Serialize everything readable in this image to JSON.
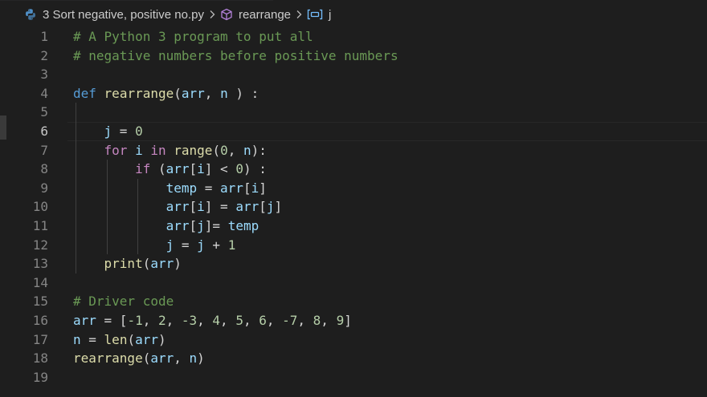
{
  "breadcrumb": {
    "file": "3 Sort negative, positive no.py",
    "function": "rearrange",
    "variable": "j"
  },
  "editor": {
    "current_line": 6,
    "lines": [
      {
        "n": "1",
        "tokens": [
          {
            "t": "# A Python 3 program to put all",
            "c": "comment"
          }
        ]
      },
      {
        "n": "2",
        "tokens": [
          {
            "t": "# negative numbers before positive numbers",
            "c": "comment"
          }
        ]
      },
      {
        "n": "3",
        "tokens": []
      },
      {
        "n": "4",
        "tokens": [
          {
            "t": "def",
            "c": "kw"
          },
          {
            "t": " ",
            "c": "plain"
          },
          {
            "t": "rearrange",
            "c": "fn"
          },
          {
            "t": "(",
            "c": "plain"
          },
          {
            "t": "arr",
            "c": "var"
          },
          {
            "t": ", ",
            "c": "plain"
          },
          {
            "t": "n",
            "c": "var"
          },
          {
            "t": " ) :",
            "c": "plain"
          }
        ]
      },
      {
        "n": "5",
        "tokens": []
      },
      {
        "n": "6",
        "tokens": [
          {
            "t": "    ",
            "c": "plain"
          },
          {
            "t": "j",
            "c": "var"
          },
          {
            "t": " = ",
            "c": "plain"
          },
          {
            "t": "0",
            "c": "num"
          }
        ]
      },
      {
        "n": "7",
        "tokens": [
          {
            "t": "    ",
            "c": "plain"
          },
          {
            "t": "for",
            "c": "ctrl"
          },
          {
            "t": " ",
            "c": "plain"
          },
          {
            "t": "i",
            "c": "var"
          },
          {
            "t": " ",
            "c": "plain"
          },
          {
            "t": "in",
            "c": "ctrl"
          },
          {
            "t": " ",
            "c": "plain"
          },
          {
            "t": "range",
            "c": "fn"
          },
          {
            "t": "(",
            "c": "plain"
          },
          {
            "t": "0",
            "c": "num"
          },
          {
            "t": ", ",
            "c": "plain"
          },
          {
            "t": "n",
            "c": "var"
          },
          {
            "t": "):",
            "c": "plain"
          }
        ]
      },
      {
        "n": "8",
        "tokens": [
          {
            "t": "        ",
            "c": "plain"
          },
          {
            "t": "if",
            "c": "ctrl"
          },
          {
            "t": " (",
            "c": "plain"
          },
          {
            "t": "arr",
            "c": "var"
          },
          {
            "t": "[",
            "c": "plain"
          },
          {
            "t": "i",
            "c": "var"
          },
          {
            "t": "] < ",
            "c": "plain"
          },
          {
            "t": "0",
            "c": "num"
          },
          {
            "t": ") :",
            "c": "plain"
          }
        ]
      },
      {
        "n": "9",
        "tokens": [
          {
            "t": "            ",
            "c": "plain"
          },
          {
            "t": "temp",
            "c": "var"
          },
          {
            "t": " = ",
            "c": "plain"
          },
          {
            "t": "arr",
            "c": "var"
          },
          {
            "t": "[",
            "c": "plain"
          },
          {
            "t": "i",
            "c": "var"
          },
          {
            "t": "]",
            "c": "plain"
          }
        ]
      },
      {
        "n": "10",
        "tokens": [
          {
            "t": "            ",
            "c": "plain"
          },
          {
            "t": "arr",
            "c": "var"
          },
          {
            "t": "[",
            "c": "plain"
          },
          {
            "t": "i",
            "c": "var"
          },
          {
            "t": "] = ",
            "c": "plain"
          },
          {
            "t": "arr",
            "c": "var"
          },
          {
            "t": "[",
            "c": "plain"
          },
          {
            "t": "j",
            "c": "var"
          },
          {
            "t": "]",
            "c": "plain"
          }
        ]
      },
      {
        "n": "11",
        "tokens": [
          {
            "t": "            ",
            "c": "plain"
          },
          {
            "t": "arr",
            "c": "var"
          },
          {
            "t": "[",
            "c": "plain"
          },
          {
            "t": "j",
            "c": "var"
          },
          {
            "t": "]= ",
            "c": "plain"
          },
          {
            "t": "temp",
            "c": "var"
          }
        ]
      },
      {
        "n": "12",
        "tokens": [
          {
            "t": "            ",
            "c": "plain"
          },
          {
            "t": "j",
            "c": "var"
          },
          {
            "t": " = ",
            "c": "plain"
          },
          {
            "t": "j",
            "c": "var"
          },
          {
            "t": " + ",
            "c": "plain"
          },
          {
            "t": "1",
            "c": "num"
          }
        ]
      },
      {
        "n": "13",
        "tokens": [
          {
            "t": "    ",
            "c": "plain"
          },
          {
            "t": "print",
            "c": "fn"
          },
          {
            "t": "(",
            "c": "plain"
          },
          {
            "t": "arr",
            "c": "var"
          },
          {
            "t": ")",
            "c": "plain"
          }
        ]
      },
      {
        "n": "14",
        "tokens": []
      },
      {
        "n": "15",
        "tokens": [
          {
            "t": "# Driver code",
            "c": "comment"
          }
        ]
      },
      {
        "n": "16",
        "tokens": [
          {
            "t": "arr",
            "c": "var"
          },
          {
            "t": " = [",
            "c": "plain"
          },
          {
            "t": "-1",
            "c": "num"
          },
          {
            "t": ", ",
            "c": "plain"
          },
          {
            "t": "2",
            "c": "num"
          },
          {
            "t": ", ",
            "c": "plain"
          },
          {
            "t": "-3",
            "c": "num"
          },
          {
            "t": ", ",
            "c": "plain"
          },
          {
            "t": "4",
            "c": "num"
          },
          {
            "t": ", ",
            "c": "plain"
          },
          {
            "t": "5",
            "c": "num"
          },
          {
            "t": ", ",
            "c": "plain"
          },
          {
            "t": "6",
            "c": "num"
          },
          {
            "t": ", ",
            "c": "plain"
          },
          {
            "t": "-7",
            "c": "num"
          },
          {
            "t": ", ",
            "c": "plain"
          },
          {
            "t": "8",
            "c": "num"
          },
          {
            "t": ", ",
            "c": "plain"
          },
          {
            "t": "9",
            "c": "num"
          },
          {
            "t": "]",
            "c": "plain"
          }
        ]
      },
      {
        "n": "17",
        "tokens": [
          {
            "t": "n",
            "c": "var"
          },
          {
            "t": " = ",
            "c": "plain"
          },
          {
            "t": "len",
            "c": "fn"
          },
          {
            "t": "(",
            "c": "plain"
          },
          {
            "t": "arr",
            "c": "var"
          },
          {
            "t": ")",
            "c": "plain"
          }
        ]
      },
      {
        "n": "18",
        "tokens": [
          {
            "t": "rearrange",
            "c": "fn"
          },
          {
            "t": "(",
            "c": "plain"
          },
          {
            "t": "arr",
            "c": "var"
          },
          {
            "t": ", ",
            "c": "plain"
          },
          {
            "t": "n",
            "c": "var"
          },
          {
            "t": ")",
            "c": "plain"
          }
        ]
      },
      {
        "n": "19",
        "tokens": []
      }
    ]
  },
  "colors": {
    "background": "#1e1e1e",
    "comment": "#6a9955",
    "keyword": "#569cd6",
    "control": "#c586c0",
    "function": "#dcdcaa",
    "variable": "#9cdcfe",
    "number": "#b5cea8",
    "text": "#d4d4d4",
    "line_number": "#858585"
  },
  "icons": {
    "file": "python-icon",
    "function": "cube-icon",
    "variable": "variable-icon"
  }
}
